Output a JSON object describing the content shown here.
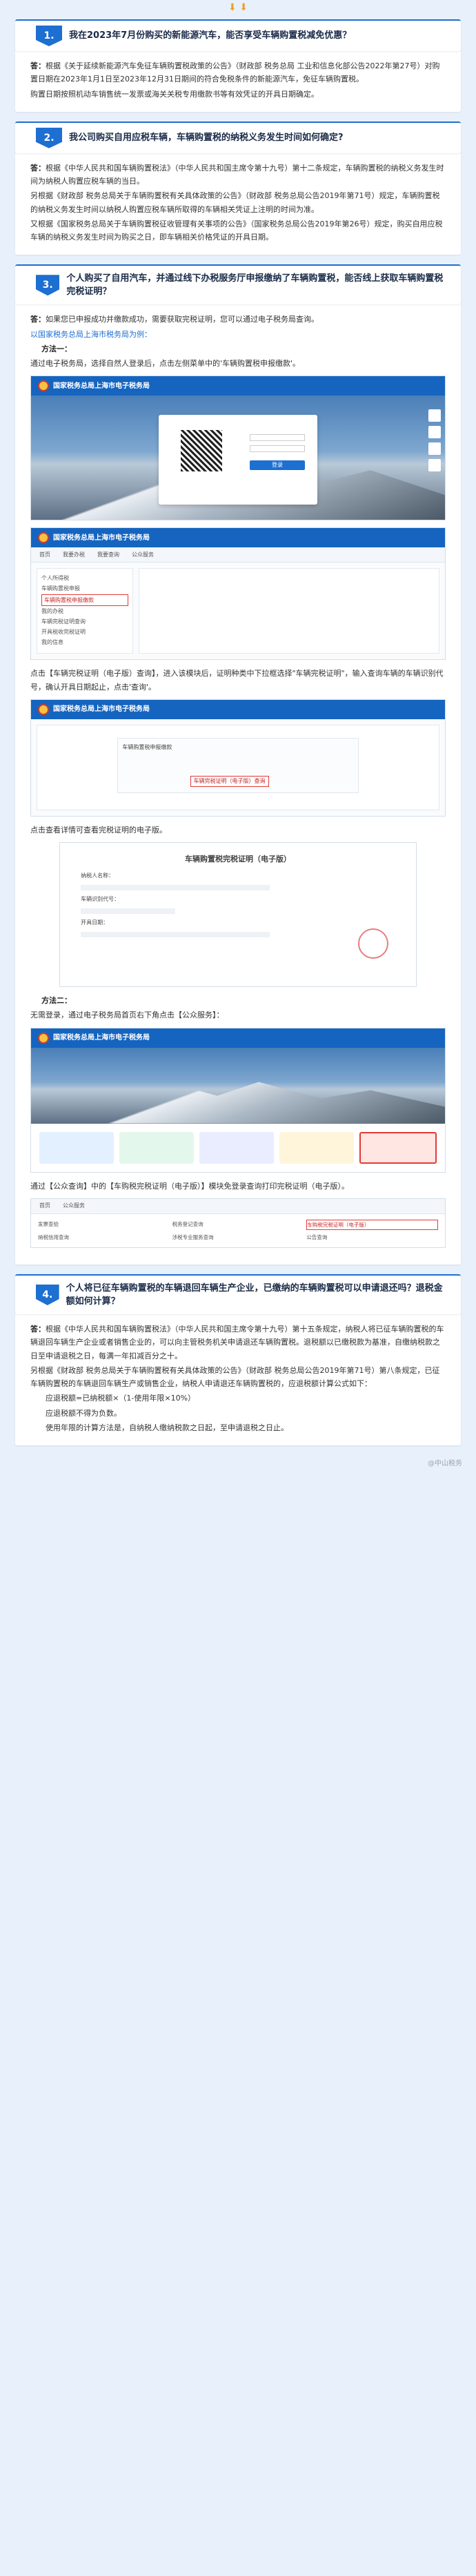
{
  "top": {
    "arrows": "⬇ ⬇"
  },
  "sections": [
    {
      "num": "1.",
      "question": "我在2023年7月份购买的新能源汽车，能否享受车辆购置税减免优惠？",
      "answer_label": "答：",
      "paragraphs": [
        "根据《关于延续新能源汽车免征车辆购置税政策的公告》（财政部 税务总局 工业和信息化部公告2022年第27号）对购置日期在2023年1月1日至2023年12月31日期间的符合免税条件的新能源汽车，免征车辆购置税。",
        "购置日期按照机动车销售统一发票或海关关税专用缴款书等有效凭证的开具日期确定。"
      ]
    },
    {
      "num": "2.",
      "question": "我公司购买自用应税车辆，车辆购置税的纳税义务发生时间如何确定?",
      "answer_label": "答：",
      "paragraphs": [
        "根据《中华人民共和国车辆购置税法》（中华人民共和国主席令第十九号）第十二条规定，车辆购置税的纳税义务发生时间为纳税人购置应税车辆的当日。",
        "另根据《财政部 税务总局关于车辆购置税有关具体政策的公告》（财政部 税务总局公告2019年第71号）规定，车辆购置税的纳税义务发生时间以纳税人购置应税车辆所取得的车辆相关凭证上注明的时间为准。",
        "又根据《国家税务总局关于车辆购置税征收管理有关事项的公告》（国家税务总局公告2019年第26号）规定，购买自用应税车辆的纳税义务发生时间为购买之日，即车辆相关价格凭证的开具日期。"
      ]
    },
    {
      "num": "3.",
      "question": "个人购买了自用汽车，并通过线下办税服务厅申报缴纳了车辆购置税，能否线上获取车辆购置税完税证明？",
      "answer_label": "答：",
      "intro": "如果您已申报成功并缴款成功，需要获取完税证明，您可以通过电子税务局查询。",
      "example": "以国家税务总局上海市税务局为例：",
      "method1": "方法一：",
      "method1_text": "通过电子税务局，选择自然人登录后，点击左侧菜单中的'车辆购置税申报缴款'。",
      "method1_step2": "点击【车辆完税证明（电子版）查询】，进入该模块后，证明种类中下拉框选择\"车辆完税证明\"，输入查询车辆的车辆识别代号，确认开具日期起止，点击'查询'。",
      "method1_step3": "点击查看详情可查看完税证明的电子版。",
      "method2": "方法二：",
      "method2_text": "无需登录，通过电子税务局首页右下角点击【公众服务】：",
      "method2_step2": "通过【公众查询】中的【车购税完税证明（电子版）】模块免登录查询打印完税证明（电子版）。"
    },
    {
      "num": "4.",
      "question": "个人将已征车辆购置税的车辆退回车辆生产企业，已缴纳的车辆购置税可以申请退还吗？退税金额如何计算？",
      "answer_label": "答：",
      "paragraphs": [
        "根据《中华人民共和国车辆购置税法》（中华人民共和国主席令第十九号）第十五条规定，纳税人将已征车辆购置税的车辆退回车辆生产企业或者销售企业的，可以向主管税务机关申请退还车辆购置税。退税额以已缴税款为基准，自缴纳税款之日至申请退税之日，每满一年扣减百分之十。",
        "另根据《财政部 税务总局关于车辆购置税有关具体政策的公告》（财政部 税务总局公告2019年第71号）第八条规定，已征车辆购置税的车辆退回车辆生产或销售企业，纳税人申请退还车辆购置税的，应退税额计算公式如下："
      ],
      "formula1": "应退税额=已纳税额×（1-使用年限×10%）",
      "formula2": "应退税额不得为负数。",
      "formula3": "使用年限的计算方法是，自纳税人缴纳税款之日起，至申请退税之日止。"
    }
  ],
  "ui": {
    "site_title": "国家税务总局上海市电子税务局",
    "login_btn": "登录",
    "nav1": "首页",
    "nav2": "我要办税",
    "nav3": "我要查询",
    "nav4": "公众服务",
    "menu": [
      "个人所得税",
      "车辆购置税申报",
      "车辆购置税申报缴款",
      "我的办税",
      "车辆完税证明查询",
      "开具税收完税证明",
      "我的信息"
    ],
    "menu_hl_index": 2,
    "cert_box_text": "车辆购置税申报缴款",
    "cert_box_hl": "车辆完税证明（电子版）查询",
    "cert_title": "车辆购置税完税证明（电子版）",
    "cert_label1": "纳税人名称：",
    "cert_label2": "车辆识别代号：",
    "cert_label3": "开具日期：",
    "svc_items": [
      "发票查验",
      "税务登记查询",
      "车购税完税证明（电子版）",
      "纳税信用查询",
      "涉税专业服务查询",
      "公告查询"
    ],
    "svc_hl_index": 2
  },
  "watermark": "@中山税务"
}
